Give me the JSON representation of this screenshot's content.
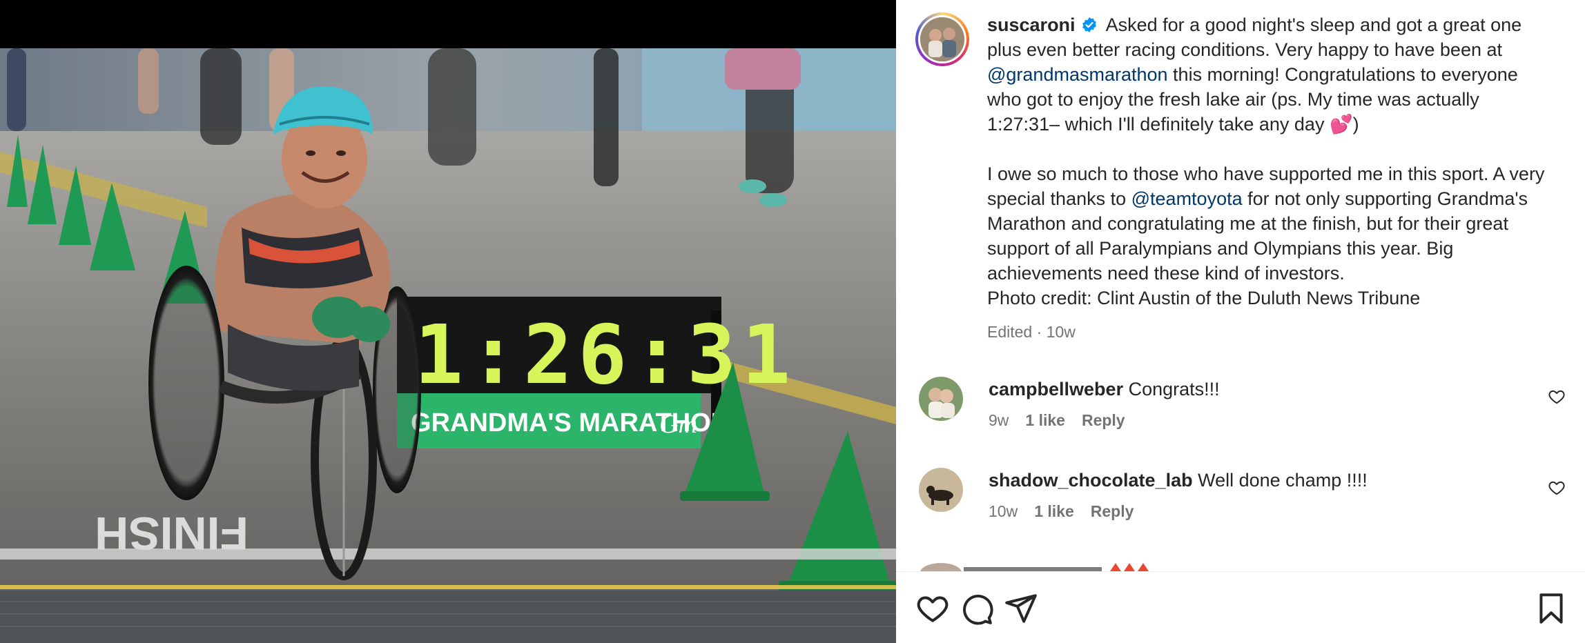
{
  "post": {
    "username": "suscaroni",
    "caption_parts": [
      {
        "type": "text",
        "text": " Asked for a good night's sleep and got a great one plus even better racing conditions. Very happy to have been at "
      },
      {
        "type": "mention",
        "text": "@grandmasmarathon"
      },
      {
        "type": "text",
        "text": " this morning! Congratulations to everyone who got to enjoy the fresh lake air (ps. My time was actually 1:27:31– which I'll definitely take any day 💕)"
      }
    ],
    "paragraph2_parts": [
      {
        "type": "text",
        "text": "I owe so much to those who have supported me in this sport. A very special thanks to "
      },
      {
        "type": "mention",
        "text": "@teamtoyota"
      },
      {
        "type": "text",
        "text": " for not only supporting Grandma's Marathon and congratulating me at the finish, but for their great support of all Paralympians and Olympians this year. Big achievements need these kind of investors."
      }
    ],
    "photo_credit": "Photo credit: Clint Austin of the Duluth News Tribune",
    "edited_label": "Edited",
    "separator": "·",
    "age": "10w"
  },
  "media": {
    "clock_text": "1:26:31",
    "banner_text": "GRANDMA'S MARATHON",
    "banner_logo": "Gm",
    "road_text": "FINISH"
  },
  "comments": [
    {
      "username": "campbellweber",
      "text": "Congrats!!!",
      "age": "9w",
      "likes": "1 like",
      "reply": "Reply"
    },
    {
      "username": "shadow_chocolate_lab",
      "text": "Well done champ !!!!",
      "age": "10w",
      "likes": "1 like",
      "reply": "Reply"
    }
  ],
  "icons": {
    "like": "heart-icon",
    "comment": "comment-bubble-icon",
    "share": "paper-plane-icon",
    "save": "bookmark-icon",
    "verified": "verified-badge-icon"
  },
  "colors": {
    "text": "#262626",
    "muted": "#737373",
    "mention": "#00376b",
    "verified": "#0095f6",
    "cone": "#1e9a4a",
    "clock_digits": "#d6f55a"
  }
}
